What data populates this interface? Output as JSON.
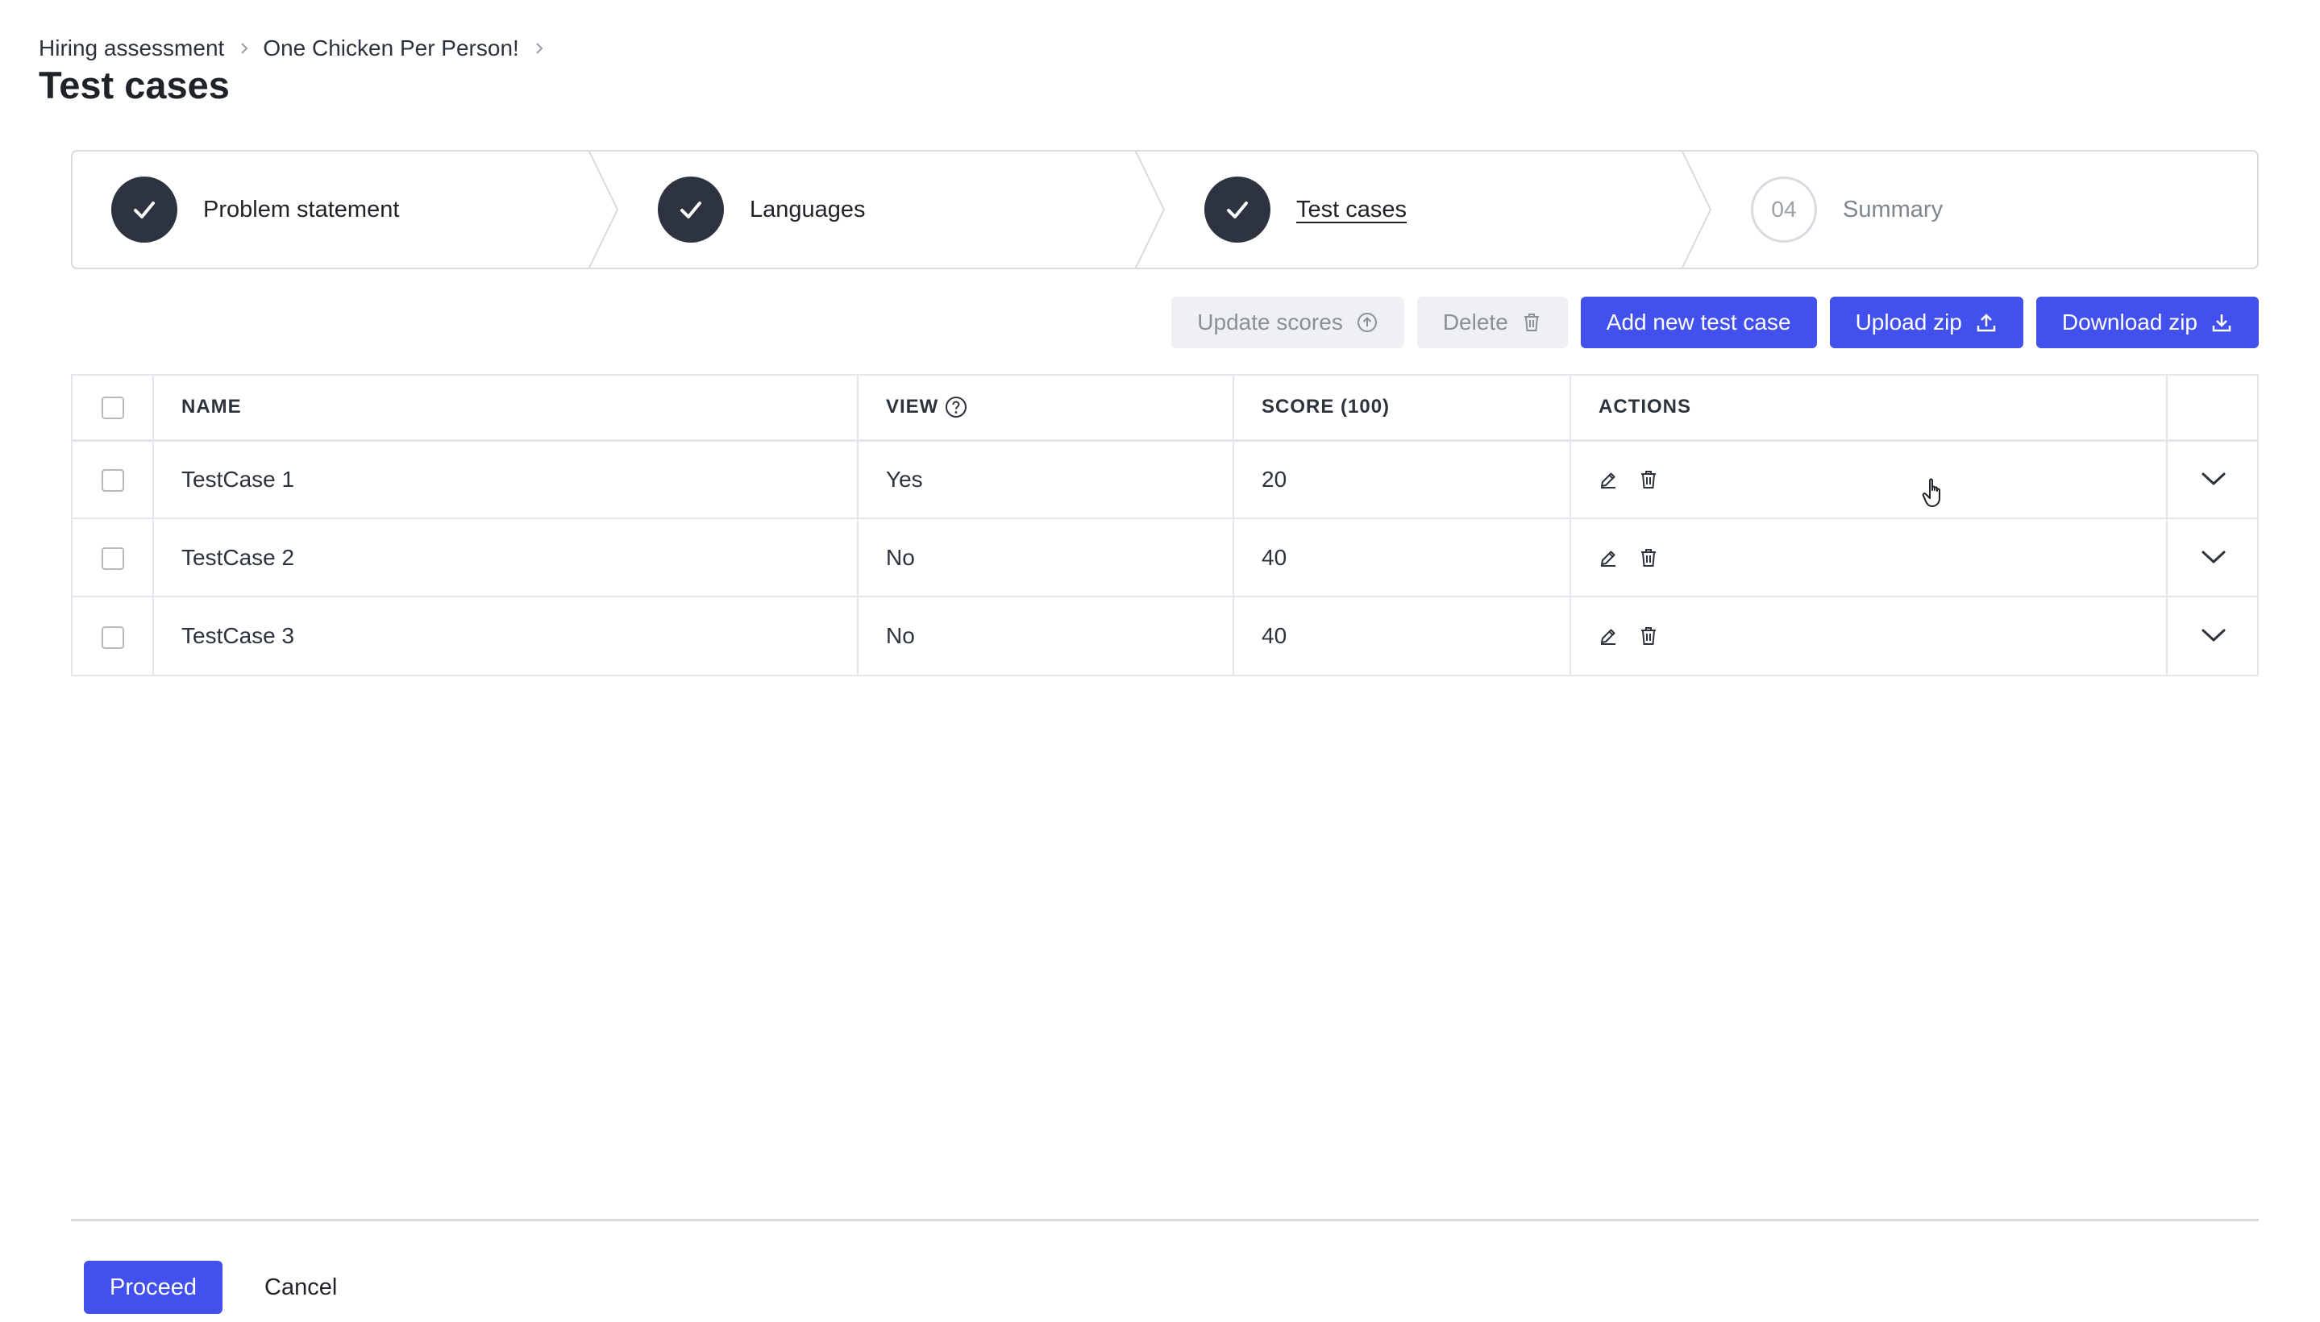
{
  "breadcrumb": {
    "items": [
      "Hiring assessment",
      "One Chicken Per Person!"
    ]
  },
  "page_title": "Test cases",
  "stepper": {
    "steps": [
      {
        "label": "Problem statement",
        "status": "completed",
        "marker": ""
      },
      {
        "label": "Languages",
        "status": "completed",
        "marker": ""
      },
      {
        "label": "Test cases",
        "status": "current",
        "marker": ""
      },
      {
        "label": "Summary",
        "status": "pending",
        "marker": "04"
      }
    ]
  },
  "toolbar": {
    "update_scores": "Update scores",
    "delete": "Delete",
    "add_new": "Add new test case",
    "upload_zip": "Upload zip",
    "download_zip": "Download zip"
  },
  "table": {
    "columns": [
      "NAME",
      "VIEW",
      "SCORE (100)",
      "ACTIONS"
    ],
    "rows": [
      {
        "name": "TestCase 1",
        "view": "Yes",
        "score": "20"
      },
      {
        "name": "TestCase 2",
        "view": "No",
        "score": "40"
      },
      {
        "name": "TestCase 3",
        "view": "No",
        "score": "40"
      }
    ]
  },
  "footer": {
    "proceed": "Proceed",
    "cancel": "Cancel"
  },
  "colors": {
    "primary": "#4250ee",
    "step_complete": "#2d3440",
    "disabled_bg": "#eef0f3",
    "border": "#e3e6ea"
  },
  "icons": [
    "chevron-right-icon",
    "check-icon",
    "arrow-up-circle-icon",
    "trash-icon",
    "upload-icon",
    "download-icon",
    "question-circle-icon",
    "pencil-icon",
    "chevron-down-icon",
    "hand-cursor-icon"
  ]
}
